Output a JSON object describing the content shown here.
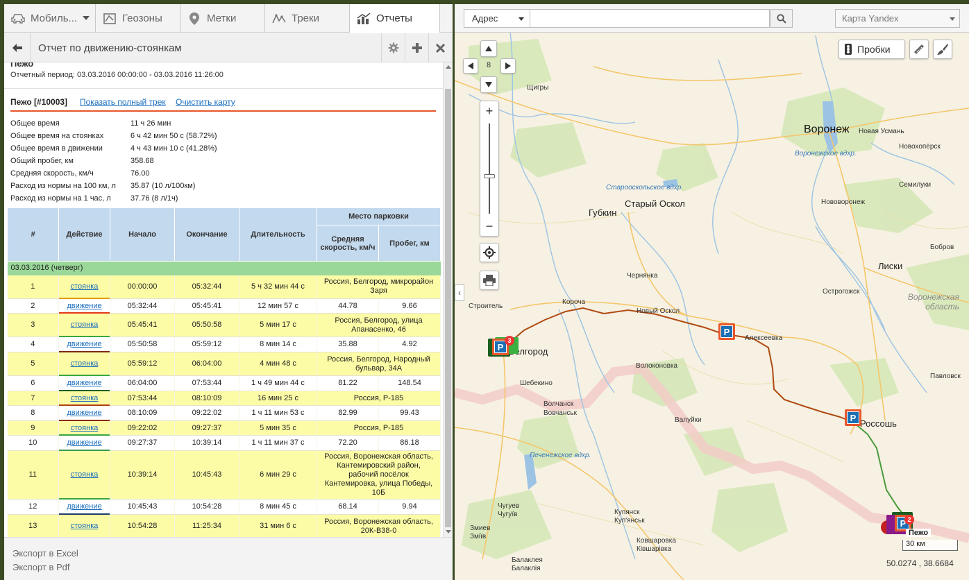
{
  "tabs": [
    {
      "label": "Мобиль...",
      "icon": "car-icon"
    },
    {
      "label": "Геозоны",
      "icon": "geozone-icon"
    },
    {
      "label": "Метки",
      "icon": "map-pin-icon"
    },
    {
      "label": "Треки",
      "icon": "track-icon"
    },
    {
      "label": "Отчеты",
      "icon": "chart-icon"
    }
  ],
  "report": {
    "title": "Отчет по движению-стоянкам",
    "cut_title": "Пежо",
    "period": "Отчетный период: 03.03.2016 00:00:00 - 03.03.2016 11:26:00",
    "vehicle": "Пежо [#10003]",
    "show_full_track": "Показать полный трек",
    "clear_map": "Очистить карту"
  },
  "summary": [
    {
      "k": "Общее время",
      "v": "11 ч 26 мин"
    },
    {
      "k": "Общее время на стоянках",
      "v": "6 ч 42 мин 50 с (58.72%)"
    },
    {
      "k": "Общее время в движении",
      "v": "4 ч 43 мин 10 с (41.28%)"
    },
    {
      "k": "Общий пробег, км",
      "v": "358.68"
    },
    {
      "k": "Средняя скорость, км/ч",
      "v": "76.00"
    },
    {
      "k": "Расход из нормы на 100 км, л",
      "v": "35.87 (10 л/100км)"
    },
    {
      "k": "Расход из нормы на 1 час, л",
      "v": "37.76 (8 л/1ч)"
    }
  ],
  "table": {
    "headers": {
      "num": "#",
      "action": "Действие",
      "start": "Начало",
      "end": "Окончание",
      "duration": "Длительность",
      "place": "Место парковки",
      "avg_speed": "Средняя скорость, км/ч",
      "mileage": "Пробег, км"
    },
    "day": "03.03.2016 (четверг)",
    "rows": [
      {
        "n": "1",
        "type": "park",
        "action": "стоянка",
        "start": "00:00:00",
        "end": "05:32:44",
        "dur": "5 ч 32 мин 44 с",
        "place": "Россия, Белгород, микрорайон Заря",
        "line": "#e0a000"
      },
      {
        "n": "2",
        "type": "move",
        "action": "движение",
        "start": "05:32:44",
        "end": "05:45:41",
        "dur": "12 мин 57 с",
        "speed": "44.78",
        "km": "9.66",
        "line": "#e33a1a"
      },
      {
        "n": "3",
        "type": "park",
        "action": "стоянка",
        "start": "05:45:41",
        "end": "05:50:58",
        "dur": "5 мин 17 с",
        "place": "Россия, Белгород, улица Апанасенко, 46",
        "line": "#3aa640"
      },
      {
        "n": "4",
        "type": "move",
        "action": "движение",
        "start": "05:50:58",
        "end": "05:59:12",
        "dur": "8 мин 14 с",
        "speed": "35.88",
        "km": "4.92",
        "line": "#7a2a12"
      },
      {
        "n": "5",
        "type": "park",
        "action": "стоянка",
        "start": "05:59:12",
        "end": "06:04:00",
        "dur": "4 мин 48 с",
        "place": "Россия, Белгород, Народный бульвар, 34А",
        "line": "#3aa640"
      },
      {
        "n": "6",
        "type": "move",
        "action": "движение",
        "start": "06:04:00",
        "end": "07:53:44",
        "dur": "1 ч 49 мин 44 с",
        "speed": "81.22",
        "km": "148.54",
        "line": "#1f5e2a"
      },
      {
        "n": "7",
        "type": "park",
        "action": "стоянка",
        "start": "07:53:44",
        "end": "08:10:09",
        "dur": "16 мин 25 с",
        "place": "Россия, Р-185",
        "line": "#b04010"
      },
      {
        "n": "8",
        "type": "move",
        "action": "движение",
        "start": "08:10:09",
        "end": "09:22:02",
        "dur": "1 ч 11 мин 53 с",
        "speed": "82.99",
        "km": "99.43",
        "line": "#8a2a12"
      },
      {
        "n": "9",
        "type": "park",
        "action": "стоянка",
        "start": "09:22:02",
        "end": "09:27:37",
        "dur": "5 мин 35 с",
        "place": "Россия, Р-185",
        "line": "#3aa640"
      },
      {
        "n": "10",
        "type": "move",
        "action": "движение",
        "start": "09:27:37",
        "end": "10:39:14",
        "dur": "1 ч 11 мин 37 с",
        "speed": "72.20",
        "km": "86.18",
        "line": "#3a9a50"
      },
      {
        "n": "11",
        "type": "park",
        "action": "стоянка",
        "start": "10:39:14",
        "end": "10:45:43",
        "dur": "6 мин 29 с",
        "place": "Россия, Воронежская область, Кантемировский район, рабочий посёлок Кантемировка, улица Победы, 10Б",
        "line": "#3aa640"
      },
      {
        "n": "12",
        "type": "move",
        "action": "движение",
        "start": "10:45:43",
        "end": "10:54:28",
        "dur": "8 мин 45 с",
        "speed": "68.14",
        "km": "9.94",
        "line": "#1f3e6a"
      },
      {
        "n": "13",
        "type": "park",
        "action": "стоянка",
        "start": "10:54:28",
        "end": "11:25:34",
        "dur": "31 мин 6 с",
        "place": "Россия, Воронежская область, 20К-В38-0",
        "line": "#3aa640"
      }
    ]
  },
  "footer": {
    "excel": "Экспорт в Excel",
    "pdf": "Экспорт в Pdf"
  },
  "map": {
    "address_type": "Адрес",
    "address_value": "",
    "map_provider": "Карта Yandex",
    "zoom_level": "8",
    "traffic": "Пробки",
    "scale": "30 км",
    "coords": "50.0274 , 38.6684",
    "car_label": "Пежо",
    "cluster_counts": [
      "3",
      "2"
    ],
    "cities": [
      {
        "name": "Воронеж",
        "size": "major"
      },
      {
        "name": "Новая Усмань",
        "size": "small"
      },
      {
        "name": "Старый Оскол",
        "size": "medium"
      },
      {
        "name": "Губкин",
        "size": "medium"
      },
      {
        "name": "Лиски",
        "size": "medium"
      },
      {
        "name": "Россошь",
        "size": "medium"
      },
      {
        "name": "Белгород",
        "size": "medium"
      },
      {
        "name": "Новый Оскол",
        "size": "small"
      },
      {
        "name": "Короча",
        "size": "small"
      },
      {
        "name": "Строитель",
        "size": "small"
      },
      {
        "name": "Алексеевка",
        "size": "small"
      },
      {
        "name": "Валуйки",
        "size": "small"
      },
      {
        "name": "Шебекино",
        "size": "small"
      },
      {
        "name": "Волоконовка",
        "size": "small"
      },
      {
        "name": "Чернянка",
        "size": "small"
      },
      {
        "name": "Острогожск",
        "size": "small"
      },
      {
        "name": "Волчанск",
        "size": "small"
      },
      {
        "name": "Вовчанськ",
        "size": "small"
      },
      {
        "name": "Чугуев",
        "size": "small"
      },
      {
        "name": "Чугуїв",
        "size": "small"
      },
      {
        "name": "Купянск",
        "size": "small"
      },
      {
        "name": "Куп'янськ",
        "size": "small"
      },
      {
        "name": "Змиев",
        "size": "small"
      },
      {
        "name": "Зміїв",
        "size": "small"
      },
      {
        "name": "Балаклея",
        "size": "small"
      },
      {
        "name": "Балаклія",
        "size": "small"
      },
      {
        "name": "Ковшаровка",
        "size": "small"
      },
      {
        "name": "Ківшарівка",
        "size": "small"
      },
      {
        "name": "Щигры",
        "size": "small"
      },
      {
        "name": "Бобров",
        "size": "small"
      },
      {
        "name": "Новохопёрск",
        "size": "small"
      },
      {
        "name": "Павловск",
        "size": "small"
      },
      {
        "name": "Нововоронеж",
        "size": "small"
      },
      {
        "name": "Семилуки",
        "size": "small"
      },
      {
        "name": "Воронежская область",
        "size": "region"
      },
      {
        "name": "Старооскольское вдхр.",
        "size": "water"
      },
      {
        "name": "Воронежское вдхр.",
        "size": "water"
      },
      {
        "name": "Печенежское вдхр.",
        "size": "water"
      }
    ]
  }
}
